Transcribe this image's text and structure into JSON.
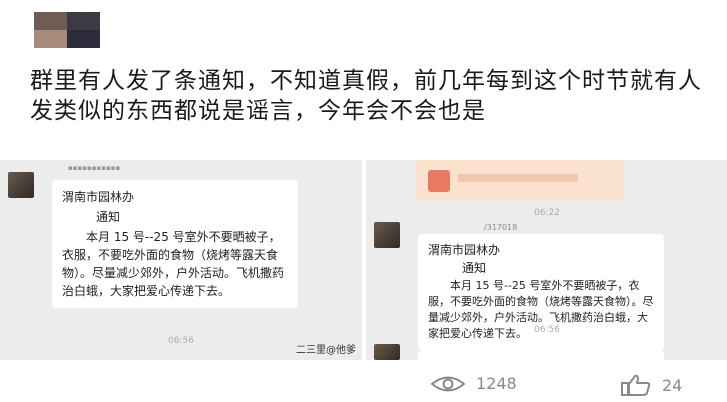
{
  "post": {
    "text": "群里有人发了条通知，不知道真假，前几年每到这个时节就有人发类似的东西都说是谣言，今年会不会也是"
  },
  "left_chat": {
    "org": "渭南市园林办",
    "title": "通知",
    "body": "本月 15 号--25 号室外不要晒被子，衣服，不要吃外面的食物（烧烤等露天食物）。尽量减少郊外，户外活动。飞机撒药治白蛾，大家把爱心传递下去。",
    "time": "06:56",
    "footer": "二三里@他爹"
  },
  "right_chat": {
    "time_top": "06:22",
    "sender": "/317018",
    "org": "渭南市园林办",
    "title": "通知",
    "body": "本月 15 号--25 号室外不要晒被子，衣服，不要吃外面的食物（烧烤等露天食物）。尽量减少郊外，户外活动。飞机撒药治白蛾，大家把爱心传递下去。",
    "time": "06:56"
  },
  "stats": {
    "views": "1248",
    "likes": "24"
  },
  "colors": {
    "accent_orange": "#e87a62",
    "chat_bg": "#ececec",
    "stat_gray": "#8a8a8a"
  },
  "icons": {
    "views": "eye-icon",
    "likes": "thumbs-up-icon"
  }
}
